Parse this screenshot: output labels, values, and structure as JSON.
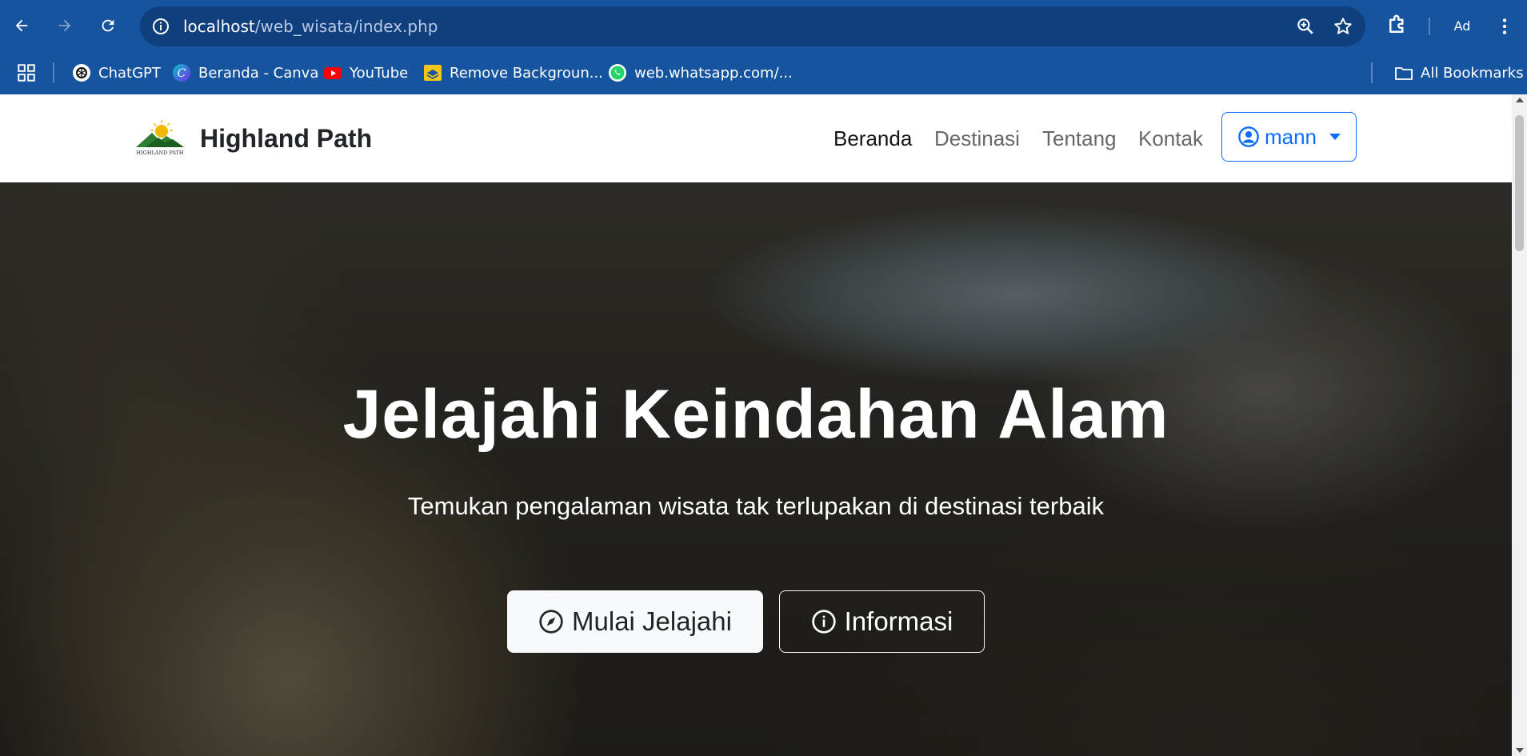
{
  "browser": {
    "url_host": "localhost",
    "url_path": "/web_wisata/index.php",
    "profile_label": "Ad",
    "bookmarks": [
      {
        "label": "ChatGPT",
        "icon": "chatgpt-icon"
      },
      {
        "label": "Beranda - Canva",
        "icon": "canva-icon"
      },
      {
        "label": "YouTube",
        "icon": "youtube-icon"
      },
      {
        "label": "Remove Backgroun...",
        "icon": "remove-bg-icon"
      },
      {
        "label": "web.whatsapp.com/...",
        "icon": "whatsapp-icon"
      }
    ],
    "all_bookmarks_label": "All Bookmarks"
  },
  "site": {
    "brand": "Highland Path",
    "nav": [
      "Beranda",
      "Destinasi",
      "Tentang",
      "Kontak"
    ],
    "user_label": "mann"
  },
  "hero": {
    "title": "Jelajahi Keindahan Alam",
    "subtitle": "Temukan pengalaman wisata tak terlupakan di destinasi terbaik",
    "primary_button": "Mulai Jelajahi",
    "secondary_button": "Informasi"
  },
  "colors": {
    "chrome": "#1654a0",
    "omnibox": "#0f3f7d",
    "accent": "#0d6efd"
  }
}
